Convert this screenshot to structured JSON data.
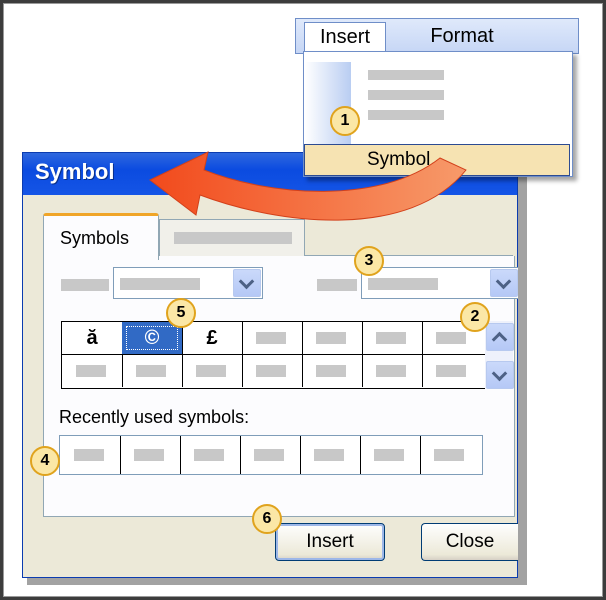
{
  "menu": {
    "insert_label": "Insert",
    "format_label": "Format",
    "symbol_item_label": "Symbol..."
  },
  "dialog": {
    "title": "Symbol",
    "tab_symbols_label": "Symbols",
    "grid_symbols": [
      "ă",
      "©",
      "£"
    ],
    "recently_used_label": "Recently used symbols:",
    "insert_button_label": "Insert",
    "close_button_label": "Close"
  },
  "callouts": [
    "1",
    "2",
    "3",
    "4",
    "5",
    "6"
  ],
  "colors": {
    "titlebar": "#0b4be0",
    "selection": "#316ac5",
    "arrow": "#f05a28",
    "callout_fill": "#fbe7a6",
    "menu_highlight": "#f6e3b2"
  },
  "icons": [
    "chevron-down-icon",
    "chevron-up-icon",
    "curved-arrow-icon"
  ]
}
